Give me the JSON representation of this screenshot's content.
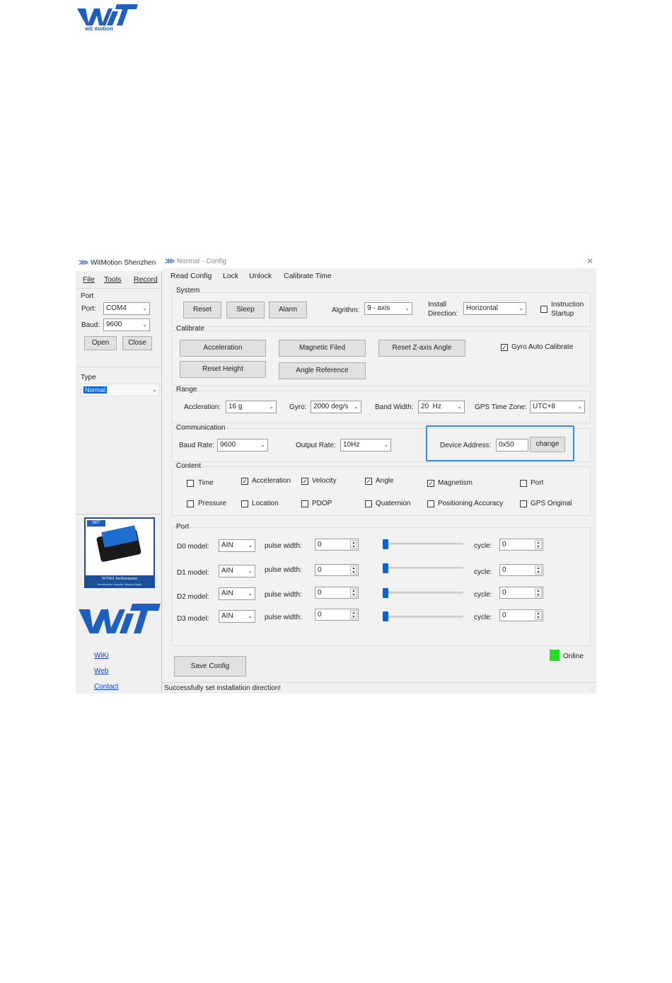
{
  "page_logo": {
    "text": "wit motion",
    "color": "#1f5fbf"
  },
  "left_window": {
    "title": "WitMotion Shenzhen",
    "menu": [
      "File",
      "Tools",
      "Record"
    ],
    "port_group": "Port",
    "port_label": "Port:",
    "port_value": "COM4",
    "baud_label": "Baud:",
    "baud_value": "9600",
    "open_label": "Open",
    "close_label": "Close",
    "type_group": "Type",
    "type_value": "Normal",
    "product_caption": "WT901 Inclinometer",
    "product_sub": "Acceleration Angular Velocity Angle",
    "links": [
      "WiKi",
      "Web",
      "Contact"
    ]
  },
  "main_window": {
    "title": "Normal - Config",
    "close_icon": "close-icon",
    "menu": [
      "Read Config",
      "Lock",
      "Unlock",
      "Calibrate Time"
    ],
    "system": {
      "title": "System",
      "reset": "Reset",
      "sleep": "Sleep",
      "alarm": "Alarm",
      "algorithm_label": "Algrithm:",
      "algorithm_value": "9 - axis",
      "install_label_1": "Install",
      "install_label_2": "Direction:",
      "install_value": "Horizontal",
      "instruction_label_1": "Instruction",
      "instruction_label_2": "Startup",
      "instruction_checked": false
    },
    "calibrate": {
      "title": "Calibrate",
      "acceleration": "Acceleration",
      "magnetic": "Magnetic Filed",
      "reset_z": "Reset Z-axis Angle",
      "gyro_auto": "Gyro Auto Calibrate",
      "gyro_auto_checked": true,
      "reset_height": "Reset Height",
      "angle_reference": "Angle Reference"
    },
    "range": {
      "title": "Range",
      "accel_label": "Accleration:",
      "accel_value": "16 g",
      "gyro_label": "Gyro:",
      "gyro_value": "2000 deg/s",
      "bw_label": "Band Width:",
      "bw_value": "20  Hz",
      "tz_label": "GPS Time Zone:",
      "tz_value": "UTC+8"
    },
    "communication": {
      "title": "Communication",
      "baud_label": "Baud Rate:",
      "baud_value": "9600",
      "rate_label": "Output Rate:",
      "rate_value": "10Hz",
      "addr_label": "Device Address:",
      "addr_value": "0x50",
      "change": "change",
      "highlight_color": "#2f8fe0"
    },
    "content": {
      "title": "Content",
      "items": [
        {
          "label": "Time",
          "checked": false
        },
        {
          "label": "Acceleration",
          "checked": true
        },
        {
          "label": "Velocity",
          "checked": true
        },
        {
          "label": "Angle",
          "checked": true
        },
        {
          "label": "Magnetism",
          "checked": true
        },
        {
          "label": "Port",
          "checked": false
        },
        {
          "label": "Pressure",
          "checked": false
        },
        {
          "label": "Location",
          "checked": false
        },
        {
          "label": "PDOP",
          "checked": false
        },
        {
          "label": "Quaternion",
          "checked": false
        },
        {
          "label": "Positioning Accuracy",
          "checked": false
        },
        {
          "label": "GPS Original",
          "checked": false
        }
      ]
    },
    "port": {
      "title": "Port",
      "rows": [
        {
          "label": "D0 model:",
          "model": "AIN",
          "pw_label": "pulse width:",
          "pw": "0",
          "cycle_label": "cycle:",
          "cycle": "0"
        },
        {
          "label": "D1 model:",
          "model": "AIN",
          "pw_label": "pulse width:",
          "pw": "0",
          "cycle_label": "cycle:",
          "cycle": "0"
        },
        {
          "label": "D2 model:",
          "model": "AIN",
          "pw_label": "pulse width:",
          "pw": "0",
          "cycle_label": "cycle:",
          "cycle": "0"
        },
        {
          "label": "D3 model:",
          "model": "AIN",
          "pw_label": "pulse width:",
          "pw": "0",
          "cycle_label": "cycle:",
          "cycle": "0"
        }
      ]
    },
    "save": "Save Config",
    "online": "Online",
    "online_color": "#22dd22",
    "status": "Successfully set installation direction!"
  }
}
